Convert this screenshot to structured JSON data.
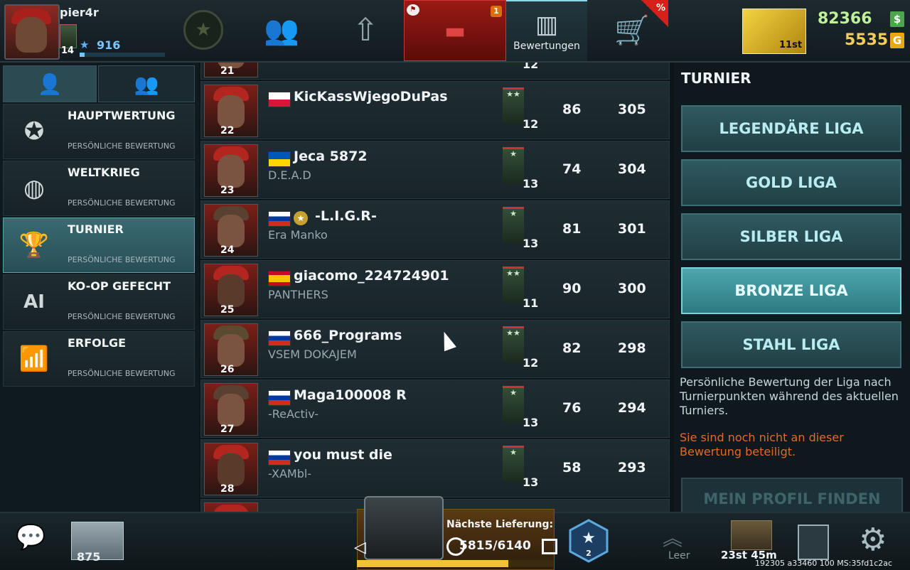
{
  "player": {
    "username": "pier4r",
    "level": "14",
    "stars": "916",
    "xp_fraction": 0.06
  },
  "topnav": {
    "ratings_label": "Bewertungen",
    "tanks_badge": "1",
    "sale_badge": "%",
    "gold_rank": "11st",
    "money": "82366",
    "money_symbol": "$",
    "gold": "5535",
    "gold_symbol": "G"
  },
  "sidebar": {
    "items": [
      {
        "title": "HAUPTWERTUNG",
        "sub": "PERSÖNLICHE BEWERTUNG"
      },
      {
        "title": "WELTKRIEG",
        "sub": "PERSÖNLICHE BEWERTUNG"
      },
      {
        "title": "TURNIER",
        "sub": "PERSÖNLICHE BEWERTUNG"
      },
      {
        "title": "KO-OP GEFECHT",
        "sub": "PERSÖNLICHE BEWERTUNG"
      },
      {
        "title": "ERFOLGE",
        "sub": "PERSÖNLICHE BEWERTUNG"
      }
    ]
  },
  "leaderboard": {
    "rows": [
      {
        "pos": "21",
        "name": "",
        "clan": "",
        "level": "12",
        "v1": "",
        "v2": "",
        "flag": ""
      },
      {
        "pos": "22",
        "name": "KicKassWjegoDuPas",
        "clan": "",
        "level": "12",
        "v1": "86",
        "v2": "305",
        "flag": "pl"
      },
      {
        "pos": "23",
        "name": "Jeca 5872",
        "clan": "D.E.A.D",
        "level": "13",
        "v1": "74",
        "v2": "304",
        "flag": "ua"
      },
      {
        "pos": "24",
        "name": "-L.I.G.R-",
        "clan": "Era Manko",
        "level": "13",
        "v1": "81",
        "v2": "301",
        "flag": "ru"
      },
      {
        "pos": "25",
        "name": "giacomo_224724901",
        "clan": "PANTHERS",
        "level": "11",
        "v1": "90",
        "v2": "300",
        "flag": "es"
      },
      {
        "pos": "26",
        "name": "666_Programs",
        "clan": "VSEM DOKAJEM",
        "level": "12",
        "v1": "82",
        "v2": "298",
        "flag": "ru"
      },
      {
        "pos": "27",
        "name": "Maga100008 R",
        "clan": "-ReActiv-",
        "level": "13",
        "v1": "76",
        "v2": "294",
        "flag": "ru"
      },
      {
        "pos": "28",
        "name": "you must die",
        "clan": "-XAMbl-",
        "level": "13",
        "v1": "58",
        "v2": "293",
        "flag": "ru"
      }
    ]
  },
  "rightpanel": {
    "title": "TURNIER",
    "leagues": [
      "LEGENDÄRE LIGA",
      "GOLD LIGA",
      "SILBER LIGA",
      "BRONZE LIGA",
      "STAHL LIGA"
    ],
    "description": "Persönliche Bewertung der Liga nach Turnierpunkten während des aktuellen Turniers.",
    "warning": "Sie sind noch nicht an dieser Bewertung beteiligt.",
    "find_button": "MEIN PROFIL FINDEN"
  },
  "bottombar": {
    "box_count": "875",
    "supply_label": "Nächste Lieferung:",
    "supply_value": "5815/6140",
    "supply_fraction": 0.77,
    "star_level": "2",
    "leer_label": "Leer",
    "chest_time": "23st 45m",
    "build_info": "192305 a33460 100 MS:35fd1c2ac"
  },
  "colors": {
    "accent": "#4ea6ae",
    "money": "#bff09a",
    "gold": "#f5cc5a",
    "warning": "#e06a2c",
    "active_tab": "#9a1a14"
  }
}
